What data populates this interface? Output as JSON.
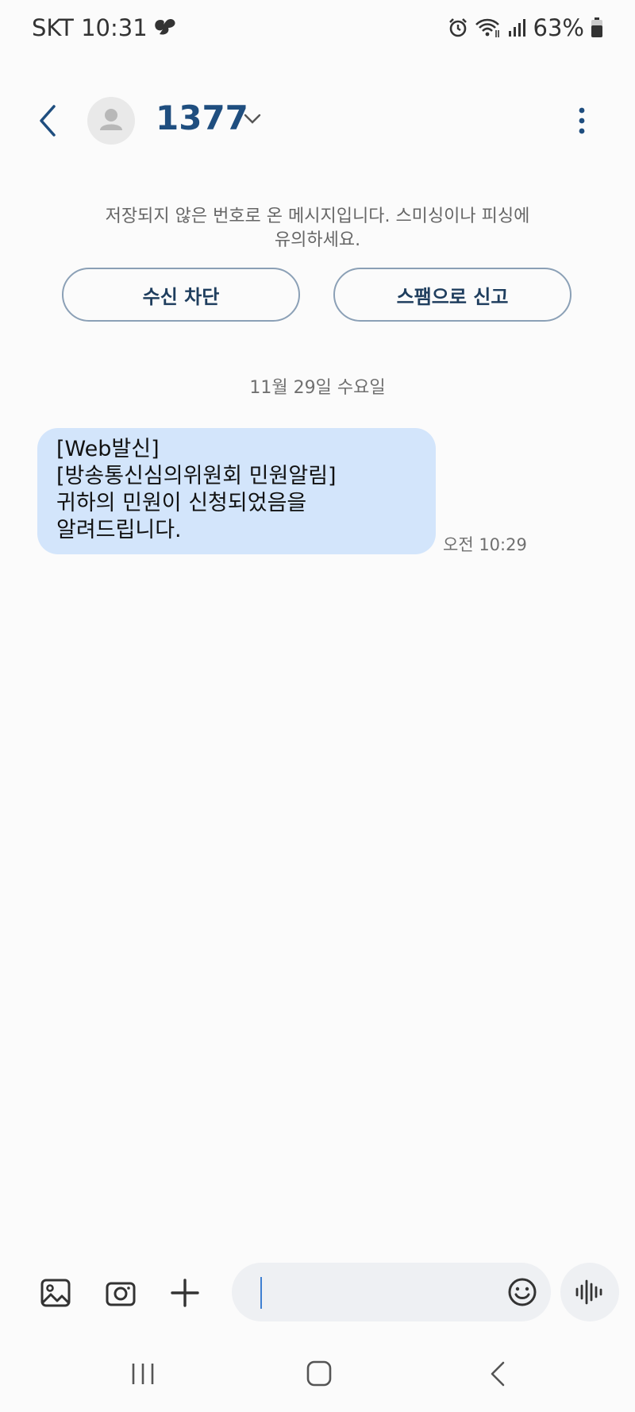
{
  "status_bar": {
    "carrier_time": "SKT 10:31",
    "battery": "63%"
  },
  "header": {
    "contact_name": "1377"
  },
  "warning": {
    "text_line1": "저장되지 않은 번호로 온 메시지입니다. 스미싱이나 피싱에",
    "text_line2": "유의하세요.",
    "block_label": "수신 차단",
    "spam_label": "스팸으로 신고"
  },
  "conversation": {
    "date": "11월 29일 수요일",
    "messages": [
      {
        "lines": [
          "[Web발신]",
          "[방송통신심의위원회 민원알림]",
          "귀하의 민원이 신청되었음을",
          "알려드립니다."
        ],
        "time": "오전 10:29"
      }
    ]
  },
  "colors": {
    "accent": "#1f4e7f",
    "bubble": "#d3e5fb",
    "background": "#fbfbfb",
    "pill_border": "#8ba0b6"
  },
  "icons": {
    "back": "chevron-left-icon",
    "more": "more-vertical-icon",
    "gallery": "gallery-icon",
    "camera": "camera-icon",
    "add": "plus-icon",
    "emoji": "emoji-icon",
    "voice": "voice-waveform-icon"
  }
}
